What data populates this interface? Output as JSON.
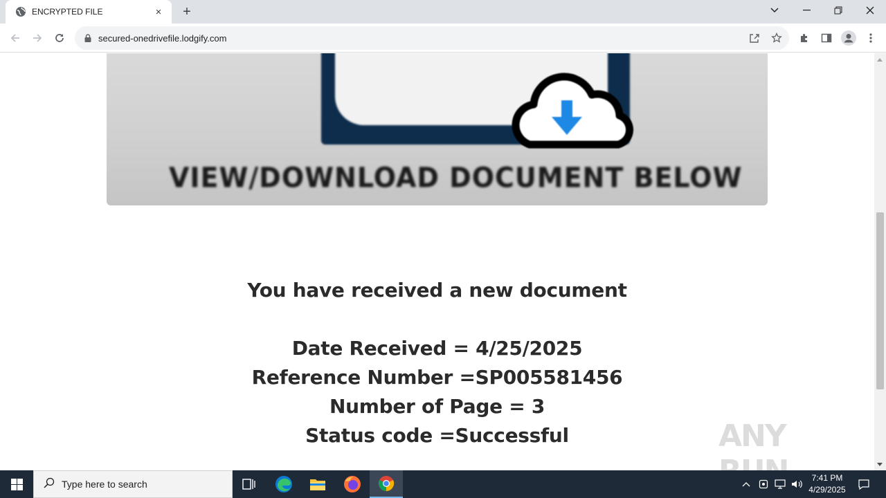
{
  "browser": {
    "tab": {
      "title": "ENCRYPTED FILE",
      "favicon": "globe-icon",
      "close_label": "×"
    },
    "new_tab_label": "+",
    "address_bar": {
      "url": "secured-onedrivefile.lodgify.com",
      "security_icon": "lock-icon"
    }
  },
  "page": {
    "banner_caption": "VIEW/DOWNLOAD DOCUMENT BELOW",
    "headline": "You have received a new document",
    "details": [
      "Date Received = 4/25/2025",
      "Reference Number =SP005581456",
      "Number of Page = 3",
      "Status code =Successful"
    ],
    "watermark": "ANY RUN"
  },
  "taskbar": {
    "search_placeholder": "Type here to search",
    "time": "7:41 PM",
    "date": "4/29/2025"
  },
  "colors": {
    "chrome_tabstrip": "#dee1e6",
    "banner_frame": "#0e2d4c",
    "download_arrow": "#1e88e5",
    "taskbar": "#1f2a38"
  }
}
